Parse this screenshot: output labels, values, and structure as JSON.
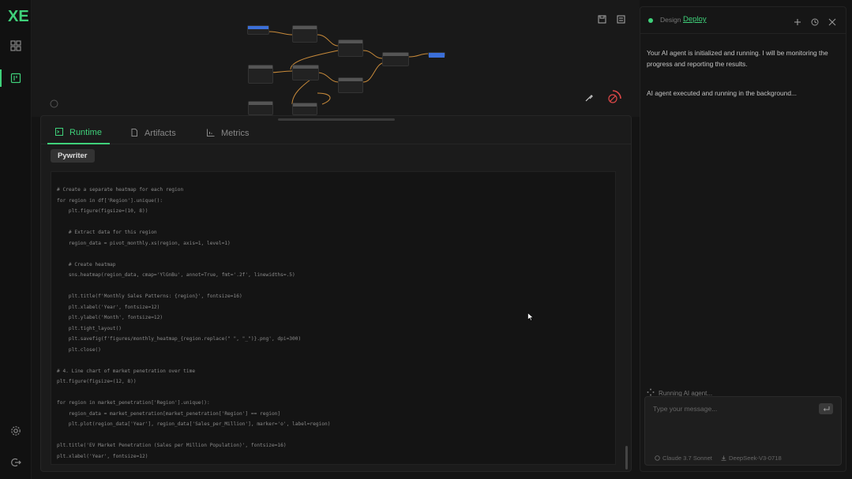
{
  "rail": {
    "logo": "XE"
  },
  "canvas": {
    "nodes": [
      {
        "id": "n1",
        "header_color": "#3b6fd8"
      },
      {
        "id": "n2",
        "header_color": "#555555"
      },
      {
        "id": "n3",
        "header_color": "#555555"
      },
      {
        "id": "n4",
        "header_color": "#555555"
      },
      {
        "id": "n5",
        "header_color": "#3b6fd8"
      },
      {
        "id": "n6",
        "header_color": "#555555"
      },
      {
        "id": "n7",
        "header_color": "#555555"
      },
      {
        "id": "n8",
        "header_color": "#555555"
      },
      {
        "id": "n9",
        "header_color": "#555555"
      },
      {
        "id": "n10",
        "header_color": "#555555"
      }
    ]
  },
  "panel": {
    "tabs": [
      {
        "label": "Runtime",
        "icon": "terminal-icon",
        "active": true
      },
      {
        "label": "Artifacts",
        "icon": "file-icon",
        "active": false
      },
      {
        "label": "Metrics",
        "icon": "chart-icon",
        "active": false
      }
    ],
    "chip": "Pywriter",
    "code": [
      "# Create a separate heatmap for each region",
      "for region in df['Region'].unique():",
      "    plt.figure(figsize=(10, 8))",
      "",
      "    # Extract data for this region",
      "    region_data = pivot_monthly.xs(region, axis=1, level=1)",
      "",
      "    # Create heatmap",
      "    sns.heatmap(region_data, cmap='YlGnBu', annot=True, fmt='.2f', linewidths=.5)",
      "",
      "    plt.title(f'Monthly Sales Patterns: {region}', fontsize=16)",
      "    plt.xlabel('Year', fontsize=12)",
      "    plt.ylabel('Month', fontsize=12)",
      "    plt.tight_layout()",
      "    plt.savefig(f'figures/monthly_heatmap_{region.replace(\" \", \"_\")}.png', dpi=300)",
      "    plt.close()",
      "",
      "# 4. Line chart of market penetration over time",
      "plt.figure(figsize=(12, 8))",
      "",
      "for region in market_penetration['Region'].unique():",
      "    region_data = market_penetration[market_penetration['Region'] == region]",
      "    plt.plot(region_data['Year'], region_data['Sales_per_Million'], marker='o', label=region)",
      "",
      "plt.title('EV Market Penetration (Sales per Million Population)', fontsize=16)",
      "plt.xlabel('Year', fontsize=12)"
    ]
  },
  "chat": {
    "mode_design": "Design",
    "mode_deploy": "Deploy",
    "messages": [
      "Your AI agent is initialized and running. I will be monitoring the progress and reporting the results.",
      "AI agent executed and running in the background..."
    ],
    "running_label": "Running AI agent...",
    "input_placeholder": "Type your message...",
    "models": [
      "Claude 3.7 Sonnet",
      "DeepSeek-V3-0718"
    ]
  },
  "colors": {
    "accent": "#3fd17a",
    "background": "#141414",
    "node_blue": "#3b6fd8",
    "stop_red": "#e04848"
  }
}
